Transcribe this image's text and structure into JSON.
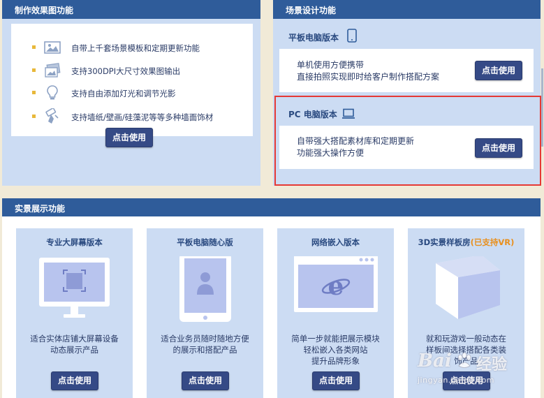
{
  "effects_panel": {
    "title": "制作效果图功能",
    "features": [
      {
        "icon": "image-icon",
        "text": "自带上千套场景模板和定期更新功能"
      },
      {
        "icon": "photos-icon",
        "text": "支持300DPI大尺寸效果图输出"
      },
      {
        "icon": "lightbulb-icon",
        "text": "支持自由添加灯光和调节光影"
      },
      {
        "icon": "wallpaper-brush-icon",
        "text": "支持墙纸/壁画/硅藻泥等等多种墙面饰材"
      }
    ],
    "button": "点击使用"
  },
  "scene_panel": {
    "title": "场景设计功能",
    "tablet": {
      "title": "平板电脑版本",
      "lines": [
        "单机使用方便携带",
        "直接拍照实现即时给客户制作搭配方案"
      ],
      "button": "点击使用"
    },
    "pc": {
      "title": "PC 电脑版本",
      "lines": [
        "自带强大搭配素材库和定期更新",
        "功能强大操作方便"
      ],
      "button": "点击使用"
    }
  },
  "showcase_panel": {
    "title": "实景展示功能",
    "cards": [
      {
        "title": "专业大屏幕版本",
        "title_extra": "",
        "lines": [
          "适合实体店铺大屏幕设备",
          "动态展示产品"
        ],
        "button": "点击使用"
      },
      {
        "title": "平板电脑随心版",
        "title_extra": "",
        "lines": [
          "适合业务员随时随地方便",
          "的展示和搭配产品"
        ],
        "button": "点击使用"
      },
      {
        "title": "网络嵌入版本",
        "title_extra": "",
        "lines": [
          "简单一步就能把展示模块",
          "轻松嵌入各类网站",
          "提升品牌形象"
        ],
        "button": "点击使用"
      },
      {
        "title": "3D实景样板房",
        "title_extra": "(已支持VR)",
        "lines": [
          "就和玩游戏一般动态在",
          "样板间选择搭配各类装",
          "饰产品"
        ],
        "button": "点击使用"
      }
    ]
  },
  "watermark": {
    "brand": "Bai",
    "cn": "经验",
    "url": "jingyan.baidu.com"
  },
  "colors": {
    "header": "#2f5c9a",
    "panel_bg": "#ccdcf3",
    "button": "#354a86",
    "highlight": "#e53935",
    "accent_orange": "#e8901e"
  }
}
